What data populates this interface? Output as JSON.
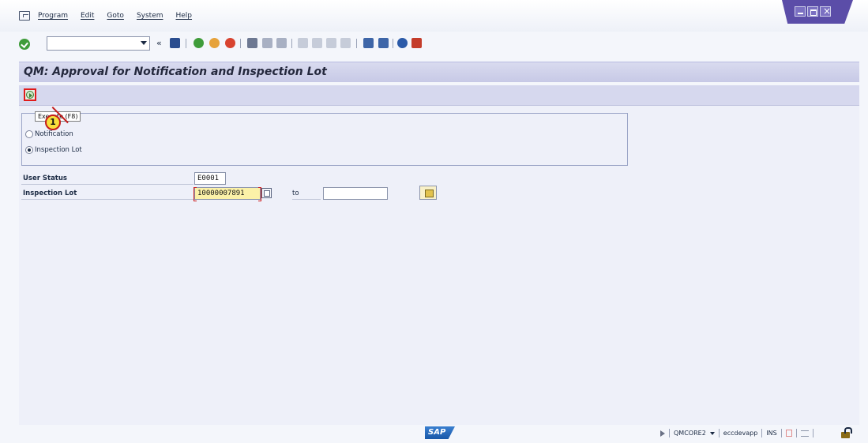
{
  "menu": {
    "items": [
      "Program",
      "Edit",
      "Goto",
      "System",
      "Help"
    ]
  },
  "toolbar": {
    "command_value": "",
    "back_glyph": "«",
    "icons": [
      "enter-icon",
      "save-icon",
      "back-icon",
      "exit-icon",
      "cancel-icon",
      "print-icon",
      "find-icon",
      "find-next-icon",
      "first-page-icon",
      "previous-page-icon",
      "next-page-icon",
      "last-page-icon",
      "create-session-icon",
      "shortcut-icon",
      "help-icon",
      "customize-layout-icon"
    ]
  },
  "page": {
    "title": "QM: Approval for Notification and Inspection Lot"
  },
  "app_toolbar": {
    "execute_tooltip": "Execute  (F8)",
    "callout_number": "1"
  },
  "selection": {
    "options": [
      {
        "label": "Notification",
        "selected": false
      },
      {
        "label": "Inspection Lot",
        "selected": true
      }
    ]
  },
  "fields": {
    "user_status_label": "User Status",
    "user_status_value": "E0001",
    "inspection_lot_label": "Inspection Lot",
    "inspection_lot_from": "10000007891",
    "to_label": "to",
    "inspection_lot_to": ""
  },
  "statusbar": {
    "logo_text": "SAP",
    "system": "QMCORE2",
    "server": "eccdevapp",
    "mode": "INS"
  },
  "colors": {
    "title_bar": "#c7c9e6",
    "app_toolbar": "#d6d8ee",
    "required_field": "#fbf1a8",
    "highlight_red": "#e01b1b",
    "callout_yellow": "#f7df3c"
  }
}
